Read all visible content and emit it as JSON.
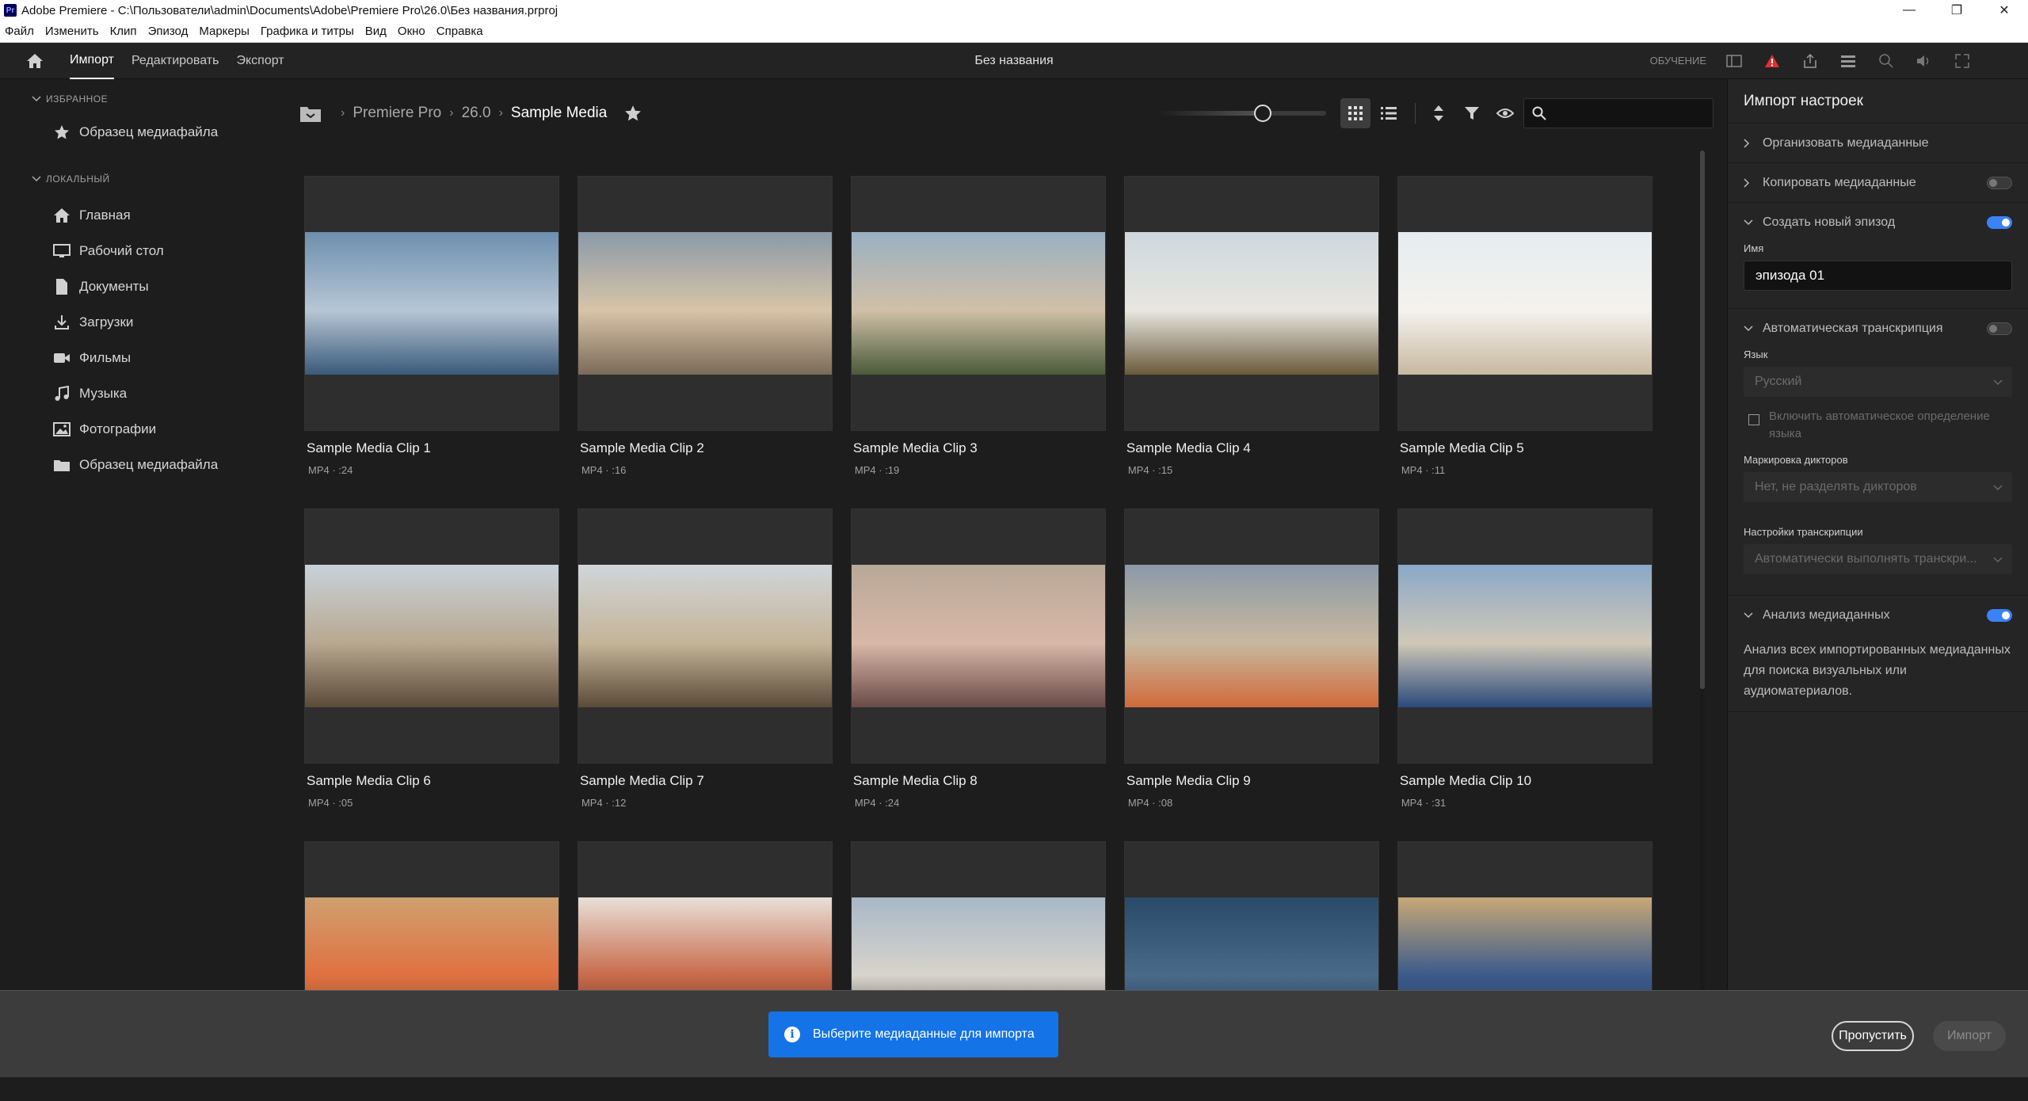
{
  "window": {
    "title": "Adobe Premiere - C:\\Пользователи\\admin\\Documents\\Adobe\\Premiere Pro\\26.0\\Без названия.prproj",
    "app_icon": "Pr"
  },
  "menu": [
    "Файл",
    "Изменить",
    "Клип",
    "Эпизод",
    "Маркеры",
    "Графика и титры",
    "Вид",
    "Окно",
    "Справка"
  ],
  "header": {
    "tabs": [
      {
        "label": "Импорт",
        "active": true
      },
      {
        "label": "Редактировать",
        "active": false
      },
      {
        "label": "Экспорт",
        "active": false
      }
    ],
    "project_title": "Без названия",
    "learn_label": "ОБУЧЕНИЕ"
  },
  "sidebar": {
    "favorites_label": "ИЗБРАННОЕ",
    "favorites": [
      {
        "label": "Образец медиафайла",
        "icon": "star-icon"
      }
    ],
    "local_label": "ЛОКАЛЬНЫЙ",
    "local": [
      {
        "label": "Главная",
        "icon": "home-icon"
      },
      {
        "label": "Рабочий стол",
        "icon": "monitor-icon"
      },
      {
        "label": "Документы",
        "icon": "document-icon"
      },
      {
        "label": "Загрузки",
        "icon": "download-icon"
      },
      {
        "label": "Фильмы",
        "icon": "video-camera-icon"
      },
      {
        "label": "Музыка",
        "icon": "music-note-icon"
      },
      {
        "label": "Фотографии",
        "icon": "image-icon"
      },
      {
        "label": "Образец медиафайла",
        "icon": "folder-icon"
      }
    ]
  },
  "breadcrumb": [
    "Premiere Pro",
    "26.0",
    "Sample Media"
  ],
  "toolbar": {
    "thumbnail_size_fraction": 0.62,
    "view_mode": "grid",
    "search_placeholder": ""
  },
  "clips": [
    {
      "name": "Sample Media Clip 1",
      "meta": "MP4 · :24"
    },
    {
      "name": "Sample Media Clip 2",
      "meta": "MP4 · :16"
    },
    {
      "name": "Sample Media Clip 3",
      "meta": "MP4 · :19"
    },
    {
      "name": "Sample Media Clip 4",
      "meta": "MP4 · :15"
    },
    {
      "name": "Sample Media Clip 5",
      "meta": "MP4 · :11"
    },
    {
      "name": "Sample Media Clip 6",
      "meta": "MP4 · :05"
    },
    {
      "name": "Sample Media Clip 7",
      "meta": "MP4 · :12"
    },
    {
      "name": "Sample Media Clip 8",
      "meta": "MP4 · :24"
    },
    {
      "name": "Sample Media Clip 9",
      "meta": "MP4 · :08"
    },
    {
      "name": "Sample Media Clip 10",
      "meta": "MP4 · :31"
    },
    {
      "name": "",
      "meta": ""
    },
    {
      "name": "",
      "meta": ""
    },
    {
      "name": "",
      "meta": ""
    },
    {
      "name": "",
      "meta": ""
    },
    {
      "name": "",
      "meta": ""
    }
  ],
  "settings": {
    "title": "Импорт настроек",
    "organize_label": "Организовать медиаданные",
    "copy_label": "Копировать медиаданные",
    "copy_enabled": false,
    "new_sequence_label": "Создать новый эпизод",
    "new_sequence_enabled": true,
    "name_label": "Имя",
    "name_value": "эпизода 01",
    "transcription_label": "Автоматическая транскрипция",
    "transcription_enabled": false,
    "language_label": "Язык",
    "language_value": "Русский",
    "auto_detect_label": "Включить автоматическое определение языка",
    "speaker_label": "Маркировка дикторов",
    "speaker_value": "Нет, не разделять дикторов",
    "transcription_settings_label": "Настройки транскрипции",
    "transcription_settings_value": "Автоматически выполнять транскри...",
    "analysis_label": "Анализ медиаданных",
    "analysis_enabled": true,
    "analysis_desc": "Анализ всех импортированных медиаданных для поиска визуальных или аудиоматериалов."
  },
  "bottom": {
    "toast": "Выберите медиаданные для импорта",
    "skip_label": "Пропустить",
    "import_label": "Импорт"
  },
  "colors": {
    "accent": "#1473e6",
    "toggle_on": "#3b82f6",
    "warning": "#e03030"
  }
}
